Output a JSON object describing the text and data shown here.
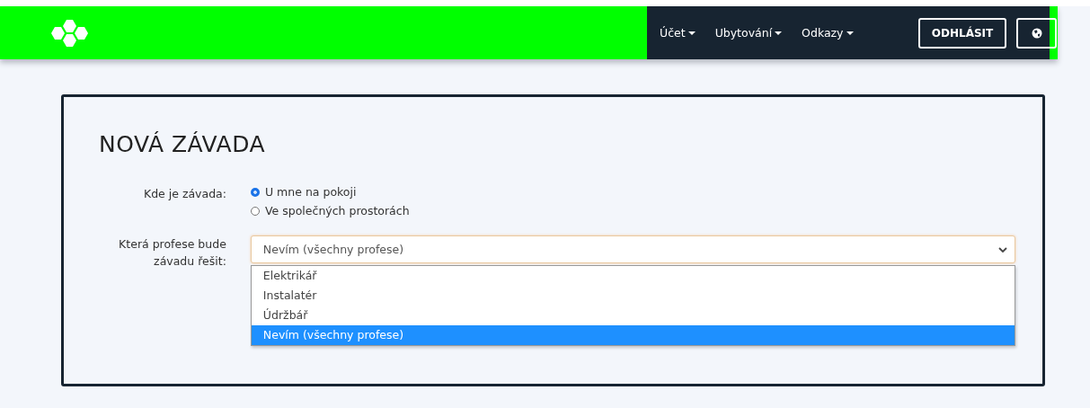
{
  "header": {
    "menus": [
      {
        "label": "Účet"
      },
      {
        "label": "Ubytování"
      },
      {
        "label": "Odkazy"
      }
    ],
    "logout_button": "ODHLÁSIT"
  },
  "form": {
    "title": "NOVÁ ZÁVADA",
    "location": {
      "label": "Kde je závada:",
      "options": [
        {
          "label": "U mne na pokoji",
          "selected": true
        },
        {
          "label": "Ve společných prostorách",
          "selected": false
        }
      ]
    },
    "profession": {
      "label": "Která profese bude závadu řešit:",
      "value": "Nevím (všechny profese)",
      "expanded": true,
      "options": [
        {
          "label": "Elektrikář",
          "selected": false
        },
        {
          "label": "Instalatér",
          "selected": false
        },
        {
          "label": "Údržbář",
          "selected": false
        },
        {
          "label": "Nevím (všechny profese)",
          "selected": true
        }
      ]
    }
  }
}
